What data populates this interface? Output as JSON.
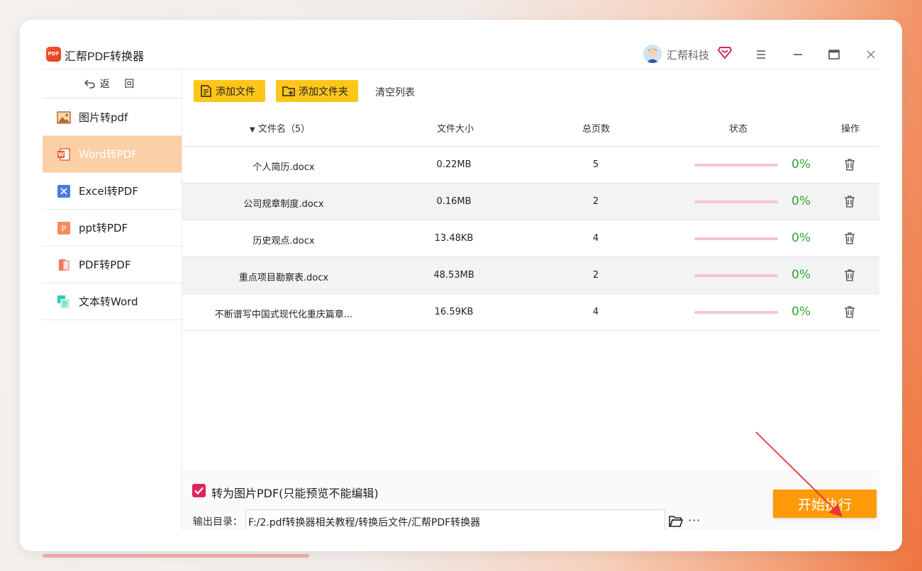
{
  "app": {
    "title": "汇帮PDF转换器",
    "logo_text": "PDF",
    "user_name": "汇帮科技"
  },
  "sidebar": {
    "back_label": "返 回",
    "items": [
      {
        "label": "图片转pdf",
        "icon": "image-icon",
        "active": false
      },
      {
        "label": "Word转PDF",
        "icon": "word-icon",
        "active": true
      },
      {
        "label": "Excel转PDF",
        "icon": "excel-icon",
        "active": false
      },
      {
        "label": "ppt转PDF",
        "icon": "ppt-icon",
        "active": false
      },
      {
        "label": "PDF转PDF",
        "icon": "pdf-icon",
        "active": false
      },
      {
        "label": "文本转Word",
        "icon": "text-icon",
        "active": false
      }
    ]
  },
  "toolbar": {
    "add_file": "添加文件",
    "add_folder": "添加文件夹",
    "clear_list": "清空列表"
  },
  "table": {
    "headers": {
      "filename": "文件名（5）",
      "size": "文件大小",
      "pages": "总页数",
      "status": "状态",
      "action": "操作"
    },
    "rows": [
      {
        "name": "个人简历.docx",
        "size": "0.22MB",
        "pages": "5",
        "progress": "0%"
      },
      {
        "name": "公司规章制度.docx",
        "size": "0.16MB",
        "pages": "2",
        "progress": "0%"
      },
      {
        "name": "历史观点.docx",
        "size": "13.48KB",
        "pages": "4",
        "progress": "0%"
      },
      {
        "name": "重点项目勘察表.docx",
        "size": "48.53MB",
        "pages": "2",
        "progress": "0%"
      },
      {
        "name": "不断谱写中国式现代化重庆篇章...",
        "size": "16.59KB",
        "pages": "4",
        "progress": "0%"
      }
    ]
  },
  "footer": {
    "image_pdf_label": "转为图片PDF(只能预览不能编辑)",
    "image_pdf_checked": true,
    "output_label": "输出目录：",
    "output_path": "F:/2.pdf转换器相关教程/转换后文件/汇帮PDF转换器",
    "more_label": "···",
    "start_button": "开始执行"
  },
  "colors": {
    "accent_yellow": "#ffc61a",
    "start_orange": "#ff9a0a",
    "active_nav": "#fdcfa6",
    "progress_green": "#2ea82e",
    "checkbox_red": "#e0245e",
    "annotation_arrow": "#e53935"
  }
}
